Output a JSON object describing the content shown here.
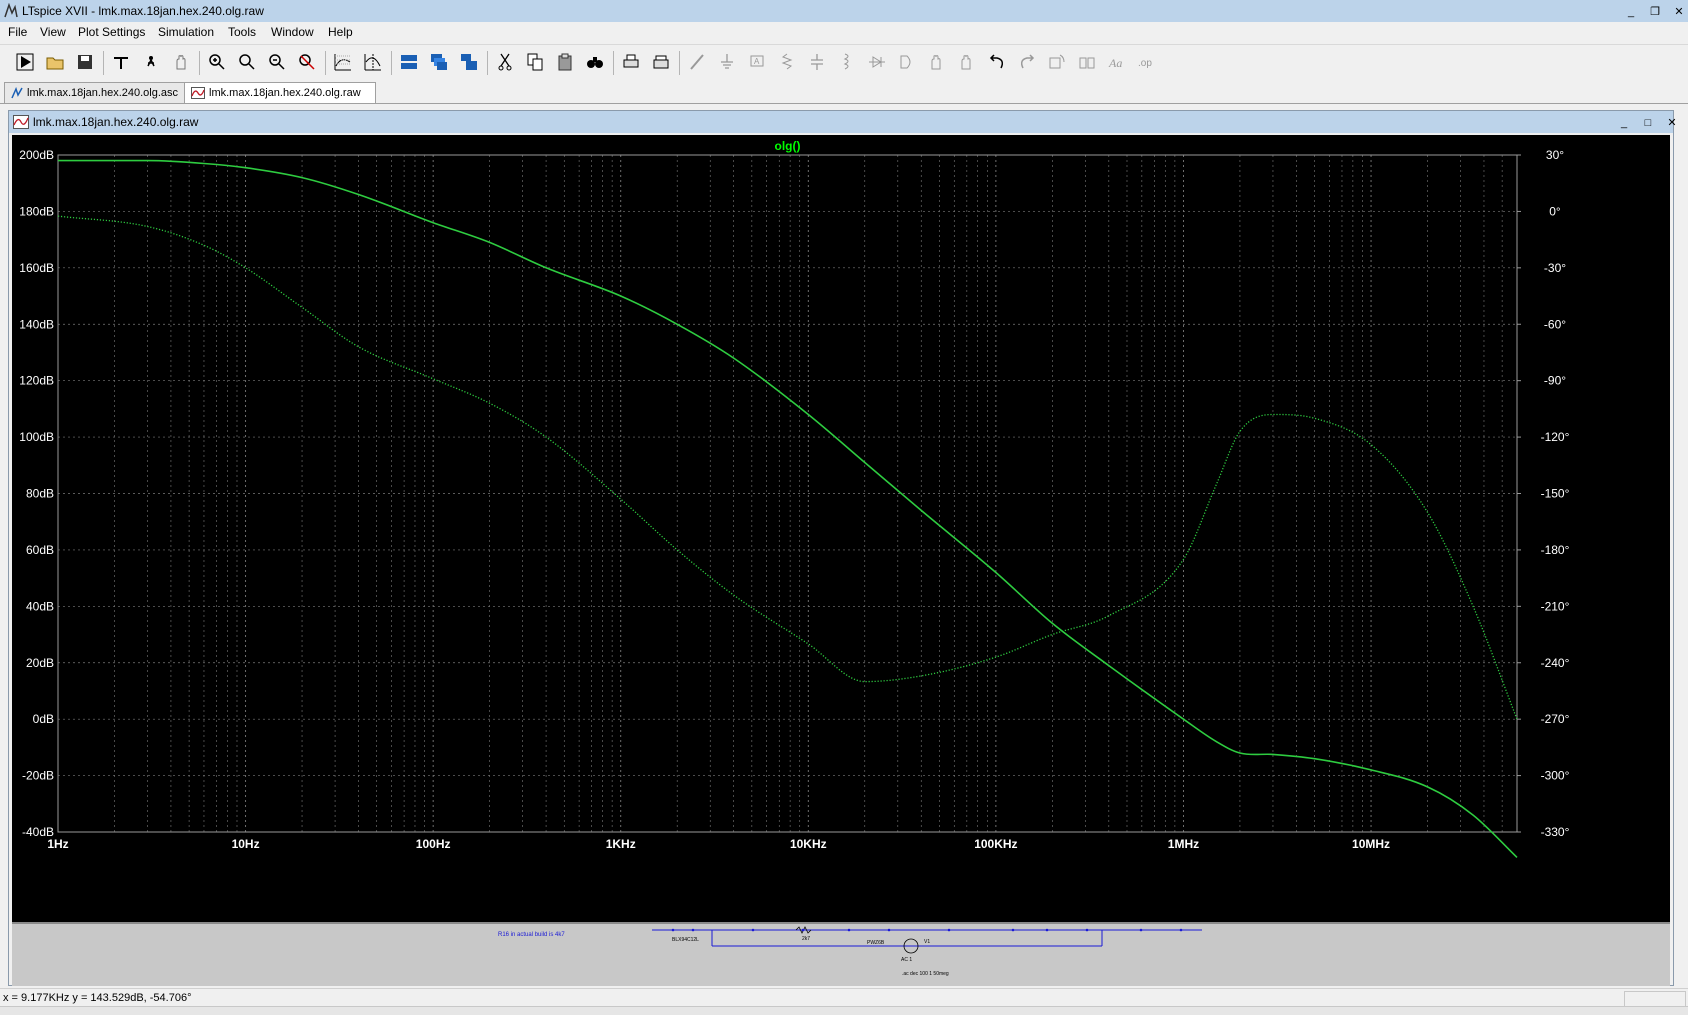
{
  "app": {
    "title": "LTspice XVII - lmk.max.18jan.hex.240.olg.raw"
  },
  "window_controls": {
    "minimize": "_",
    "restore": "❐",
    "close": "✕"
  },
  "menu": [
    "File",
    "View",
    "Plot Settings",
    "Simulation",
    "Tools",
    "Window",
    "Help"
  ],
  "toolbar": {
    "buttons": [
      "run-icon",
      "open-icon",
      "save-icon",
      "control-panel-icon",
      "halt-icon",
      "pan-hand-icon",
      "zoom-in-icon",
      "zoom-area-icon",
      "zoom-out-icon",
      "zoom-cancel-icon",
      "autorange-icon",
      "cursor-icon",
      "tile-horizontal-icon",
      "cascade-icon",
      "tile-vertical-icon",
      "cut-icon",
      "copy-icon",
      "paste-icon",
      "find-icon",
      "print-icon",
      "print-preview-icon",
      "wire-icon",
      "ground-icon",
      "label-icon",
      "resistor-icon",
      "capacitor-icon",
      "inductor-icon",
      "diode-icon",
      "component-icon",
      "move-icon",
      "drag-icon",
      "undo-icon",
      "redo-icon",
      "rotate-icon",
      "mirror-icon",
      "text-icon",
      "spice-directive-icon"
    ]
  },
  "tabs": [
    {
      "label": "lmk.max.18jan.hex.240.olg.asc",
      "icon": "schematic-icon"
    },
    {
      "label": "lmk.max.18jan.hex.240.olg.raw",
      "icon": "waveform-icon"
    }
  ],
  "plot_window": {
    "title": "lmk.max.18jan.hex.240.olg.raw"
  },
  "chart_data": {
    "type": "line",
    "title": "olg()",
    "x_scale": "log",
    "x_ticks": [
      "1Hz",
      "10Hz",
      "100Hz",
      "1KHz",
      "10KHz",
      "100KHz",
      "1MHz",
      "10MHz"
    ],
    "x_tick_values": [
      1,
      10,
      100,
      1000,
      10000,
      100000,
      1000000,
      10000000
    ],
    "xlim": [
      1,
      60000000
    ],
    "left_axis": {
      "unit": "dB",
      "ylim": [
        -40,
        200
      ],
      "ticks": [
        "200dB",
        "180dB",
        "160dB",
        "140dB",
        "120dB",
        "100dB",
        "80dB",
        "60dB",
        "40dB",
        "20dB",
        "0dB",
        "-20dB",
        "-40dB"
      ]
    },
    "right_axis": {
      "unit": "°",
      "ylim": [
        -330,
        30
      ],
      "ticks": [
        "30°",
        "0°",
        "-30°",
        "-60°",
        "-90°",
        "-120°",
        "-150°",
        "-180°",
        "-210°",
        "-240°",
        "-270°",
        "-300°",
        "-330°"
      ]
    },
    "grid": true,
    "series": [
      {
        "style": "solid",
        "axis": "left",
        "x": [
          1,
          3,
          6,
          10,
          20,
          40,
          100,
          200,
          400,
          1000,
          2000,
          4000,
          10000,
          20000,
          40000,
          100000,
          200000,
          400000,
          1000000,
          1500000,
          2000000,
          3000000,
          5000000,
          10000000,
          20000000,
          35000000,
          60000000
        ],
        "y": [
          198,
          198,
          197,
          195.5,
          192,
          186,
          176,
          169,
          160,
          150,
          140,
          128,
          108,
          91,
          74,
          52,
          34,
          19,
          0,
          -8,
          -12,
          -12.5,
          -14,
          -18,
          -24,
          -34,
          -49
        ]
      },
      {
        "style": "dotted",
        "axis": "right",
        "x": [
          1,
          3,
          6,
          10,
          20,
          40,
          100,
          200,
          400,
          1000,
          2000,
          4000,
          10000,
          20000,
          40000,
          100000,
          200000,
          400000,
          1000000,
          1500000,
          2000000,
          3000000,
          5000000,
          10000000,
          20000000,
          35000000,
          60000000
        ],
        "y": [
          -2.5,
          -8,
          -18,
          -30,
          -51,
          -72,
          -89,
          -102,
          -120,
          -153,
          -180,
          -204,
          -230,
          -250,
          -247,
          -237,
          -225,
          -215,
          -185,
          -145,
          -117,
          -108,
          -110,
          -124,
          -160,
          -210,
          -270
        ]
      }
    ]
  },
  "schematic_strip": {
    "note": "R16 in actual build is 4k7",
    "part1": "BLX94C12L",
    "part2": "2k7",
    "part3": "PWZ6B",
    "part4": "V1",
    "source": "AC 1",
    "directive": ".ac dec 100 1 50meg"
  },
  "status": {
    "cursor_readout": "x = 9.177KHz    y = 143.529dB, -54.706°"
  },
  "colors": {
    "trace": "#2ecc40",
    "title": "#00ff00",
    "grid": "#7a7a7a",
    "axis_text": "#ffffff",
    "plot_bg": "#000000",
    "schem_wire": "#1a1ad6"
  }
}
